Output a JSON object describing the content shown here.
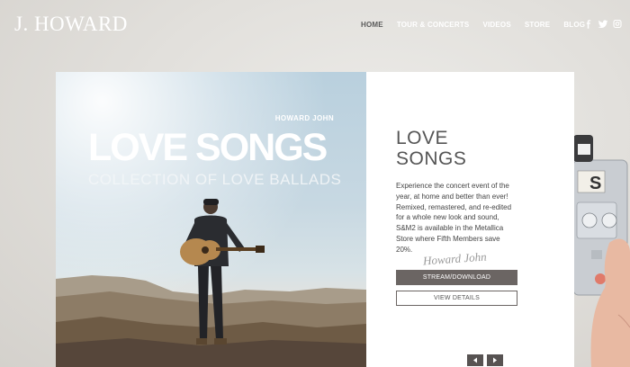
{
  "header": {
    "logo": "J. HOWARD",
    "nav": [
      {
        "label": "HOME",
        "active": true
      },
      {
        "label": "TOUR & CONCERTS",
        "active": false
      },
      {
        "label": "VIDEOS",
        "active": false
      },
      {
        "label": "STORE",
        "active": false
      },
      {
        "label": "BLOG",
        "active": false
      }
    ],
    "social_icons": [
      "facebook-icon",
      "twitter-icon",
      "instagram-icon"
    ]
  },
  "album": {
    "artist": "HOWARD JOHN",
    "title": "LOVE SONGS",
    "subtitle": "COLLECTION OF LOVE BALLADS"
  },
  "info": {
    "title_line1": "LOVE",
    "title_line2": "SONGS",
    "description": "Experience the concert event of the year, at home and better than ever! Remixed, remastered, and re-edited for a whole new look and sound, S&M2 is available in the Metallica Store where Fifth Members save 20%.",
    "signature": "Howard John",
    "stream_label": "STREAM/DOWNLOAD",
    "details_label": "VIEW DETAILS"
  },
  "colors": {
    "accent": "#6b6563",
    "nav_active": "#5a5a5a",
    "background": "#dedcd8"
  }
}
